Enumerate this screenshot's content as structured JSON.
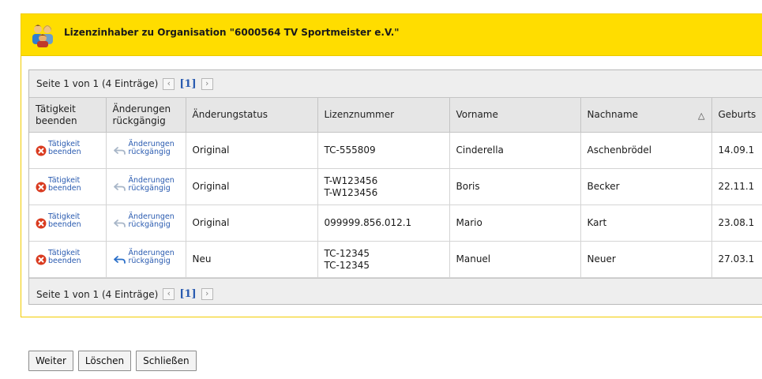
{
  "header": {
    "title": "Lizenzinhaber zu Organisation \"6000564 TV Sportmeister e.V.\""
  },
  "pager": {
    "text": "Seite 1 von 1 (4 Einträge)",
    "prev": "‹",
    "current": "[1]",
    "next": "›"
  },
  "columns": {
    "end_activity": "Tätigkeit beenden",
    "undo_changes": "Änderungen rückgängig",
    "status": "Änderungstatus",
    "license": "Lizenznummer",
    "firstname": "Vorname",
    "lastname": "Nachname",
    "birth": "Geburts",
    "sort_indicator": "△"
  },
  "row_actions": {
    "end_label": "Tätigkeit beenden",
    "undo_label": "Änderungen rückgängig",
    "end_icon": "remove-icon",
    "undo_icon": "undo-arrow-icon"
  },
  "rows": [
    {
      "status": "Original",
      "license": "TC-555809",
      "license2": "",
      "firstname": "Cinderella",
      "lastname": "Aschenbrödel",
      "birth": "14.09.1",
      "undo_active": false
    },
    {
      "status": "Original",
      "license": "T-W123456",
      "license2": "T-W123456",
      "firstname": "Boris",
      "lastname": "Becker",
      "birth": "22.11.1",
      "undo_active": false
    },
    {
      "status": "Original",
      "license": "099999.856.012.1",
      "license2": "",
      "firstname": "Mario",
      "lastname": "Kart",
      "birth": "23.08.1",
      "undo_active": false
    },
    {
      "status": "Neu",
      "license": "TC-12345",
      "license2": "TC-12345",
      "firstname": "Manuel",
      "lastname": "Neuer",
      "birth": "27.03.1",
      "undo_active": true
    }
  ],
  "buttons": {
    "next": "Weiter",
    "delete": "Löschen",
    "close": "Schließen"
  },
  "colors": {
    "header_bg": "#ffdd00",
    "link": "#2a5bb0",
    "remove_red": "#d93a1f",
    "undo_active": "#2a6fc9",
    "undo_muted": "#a8b6c8"
  }
}
